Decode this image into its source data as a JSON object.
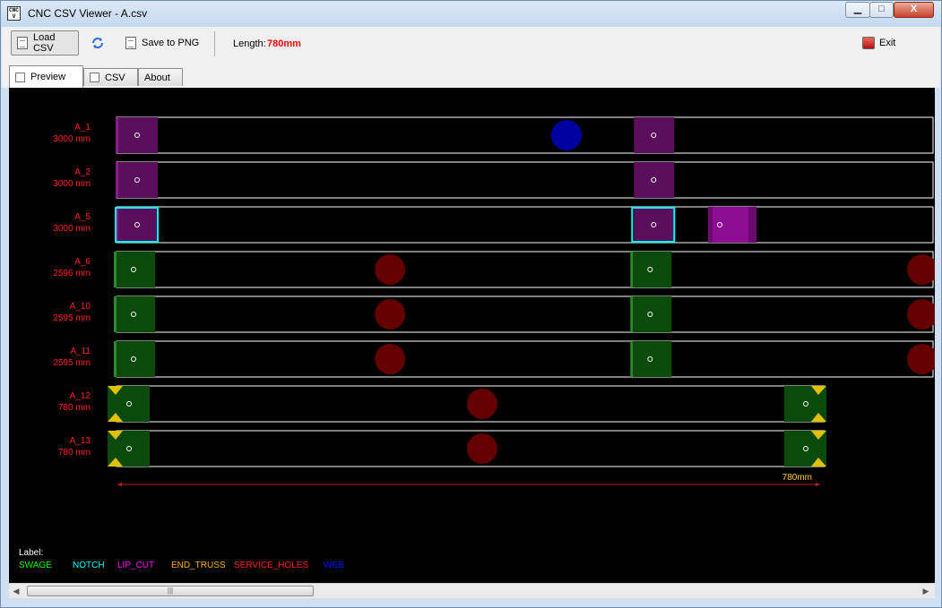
{
  "window": {
    "title": "CNC CSV Viewer - A.csv",
    "icon_text": "CNC V",
    "controls": {
      "minimize": "▁",
      "maximize": "□",
      "close": "X"
    }
  },
  "toolbar": {
    "load_label": "Load CSV",
    "save_label": "Save to PNG",
    "length_label": "Length:",
    "length_value": "780mm",
    "exit_label": "Exit"
  },
  "tabs": [
    {
      "label": "Preview",
      "active": true
    },
    {
      "label": "CSV",
      "active": false
    },
    {
      "label": "About",
      "active": false
    }
  ],
  "colors": {
    "swage": "#00ff00",
    "notch": "#00ffff",
    "lip_cut": "#ff00ff",
    "end_truss": "#ffb000",
    "service_holes": "#ff0000",
    "web": "#0000ff",
    "purple_fill": "#5a0e5c",
    "green_fill": "#0a4a0a",
    "hole_fill": "#640000",
    "web_fill": "#0000a0",
    "label_red": "#ff2020"
  },
  "members": [
    {
      "name": "A_1",
      "length": "3000 mm",
      "kind": "purple",
      "notch": false,
      "rect_start": 0,
      "rect_end": 7840,
      "features": [
        {
          "type": "block",
          "at": 0,
          "w": 0.4,
          "lipcut": true
        },
        {
          "type": "web",
          "at": 3880
        },
        {
          "type": "block",
          "at": 5020,
          "w": 0.4
        }
      ]
    },
    {
      "name": "A_2",
      "length": "3000 mm",
      "kind": "purple",
      "notch": false,
      "rect_start": 0,
      "rect_end": 7840,
      "features": [
        {
          "type": "block",
          "at": 0,
          "w": 0.4,
          "lipcut": true
        },
        {
          "type": "block",
          "at": 5020,
          "w": 0.4
        }
      ]
    },
    {
      "name": "A_5",
      "length": "3000 mm",
      "kind": "purple",
      "notch": true,
      "rect_start": 0,
      "rect_end": 7840,
      "features": [
        {
          "type": "block",
          "at": 0,
          "w": 0.4,
          "lipcut": true,
          "notch": true
        },
        {
          "type": "block",
          "at": 5020,
          "w": 0.4,
          "notch": true
        },
        {
          "type": "lipblock",
          "at": 5740,
          "w": 0.45
        }
      ]
    },
    {
      "name": "A_6",
      "length": "2596 mm",
      "kind": "green",
      "notch": false,
      "rect_start": 0,
      "rect_end": 7840,
      "features": [
        {
          "type": "gblock",
          "at": 0,
          "w": 0.4
        },
        {
          "type": "hole",
          "at": 2580
        },
        {
          "type": "gblock",
          "at": 5020,
          "w": 0.4
        },
        {
          "type": "hole",
          "at": 7760
        }
      ]
    },
    {
      "name": "A_10",
      "length": "2595 mm",
      "kind": "green",
      "notch": false,
      "rect_start": 0,
      "rect_end": 7840,
      "features": [
        {
          "type": "gblock",
          "at": 0,
          "w": 0.4
        },
        {
          "type": "hole",
          "at": 2580
        },
        {
          "type": "gblock",
          "at": 5020,
          "w": 0.4
        },
        {
          "type": "hole",
          "at": 7760
        }
      ]
    },
    {
      "name": "A_11",
      "length": "2595 mm",
      "kind": "green",
      "notch": false,
      "rect_start": 0,
      "rect_end": 7840,
      "features": [
        {
          "type": "gblock",
          "at": 0,
          "w": 0.4
        },
        {
          "type": "hole",
          "at": 2580
        },
        {
          "type": "gblock",
          "at": 5020,
          "w": 0.4
        },
        {
          "type": "hole",
          "at": 7760
        }
      ]
    },
    {
      "name": "A_12",
      "length": "780 mm",
      "kind": "short",
      "notch": false,
      "rect_start": 0,
      "rect_end": 6860,
      "features": [
        {
          "type": "tblock",
          "at": 0,
          "w": 0.4
        },
        {
          "type": "hole",
          "at": 3480
        },
        {
          "type": "tblock",
          "at": 6440,
          "w": 0.4,
          "right": true
        }
      ]
    },
    {
      "name": "A_13",
      "length": "780 mm",
      "kind": "short",
      "notch": false,
      "rect_start": 0,
      "rect_end": 6860,
      "features": [
        {
          "type": "tblock",
          "at": 0,
          "w": 0.4
        },
        {
          "type": "hole",
          "at": 3480
        },
        {
          "type": "tblock",
          "at": 6440,
          "w": 0.4,
          "right": true
        }
      ]
    }
  ],
  "dimension": {
    "label": "780mm"
  },
  "legend": {
    "title": "Label:",
    "items": [
      {
        "label": "SWAGE",
        "color": "#00ff00"
      },
      {
        "label": "NOTCH",
        "color": "#00ffff"
      },
      {
        "label": "LIP_CUT",
        "color": "#ff00ff"
      },
      {
        "label": "END_TRUSS",
        "color": "#ffb000"
      },
      {
        "label": "SERVICE_HOLES",
        "color": "#ff2020"
      },
      {
        "label": "WEB",
        "color": "#0000ff"
      }
    ]
  },
  "scrollbar": {
    "left_arrow": "◀",
    "right_arrow": "▶",
    "grip": "|||"
  }
}
